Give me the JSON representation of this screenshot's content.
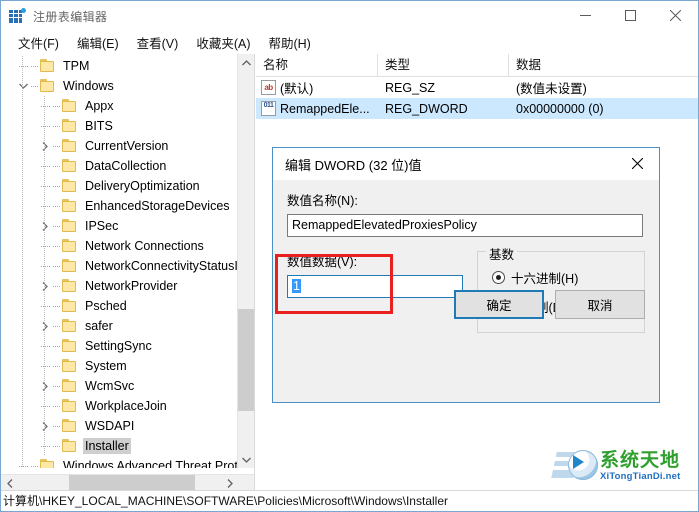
{
  "window": {
    "title": "注册表编辑器",
    "icon": "registry-editor-icon",
    "minimize": "−",
    "maximize": "□",
    "close": "✕"
  },
  "menubar": {
    "items": [
      {
        "label": "文件(F)",
        "name": "menu-file"
      },
      {
        "label": "编辑(E)",
        "name": "menu-edit"
      },
      {
        "label": "查看(V)",
        "name": "menu-view"
      },
      {
        "label": "收藏夹(A)",
        "name": "menu-favorites"
      },
      {
        "label": "帮助(H)",
        "name": "menu-help"
      }
    ]
  },
  "tree": {
    "items": [
      {
        "label": "TPM",
        "indent": 1,
        "expander": "none",
        "selected": false
      },
      {
        "label": "Windows",
        "indent": 1,
        "expander": "expanded",
        "selected": false
      },
      {
        "label": "Appx",
        "indent": 2,
        "expander": "none",
        "selected": false
      },
      {
        "label": "BITS",
        "indent": 2,
        "expander": "none",
        "selected": false
      },
      {
        "label": "CurrentVersion",
        "indent": 2,
        "expander": "collapsed",
        "selected": false
      },
      {
        "label": "DataCollection",
        "indent": 2,
        "expander": "none",
        "selected": false
      },
      {
        "label": "DeliveryOptimization",
        "indent": 2,
        "expander": "none",
        "selected": false
      },
      {
        "label": "EnhancedStorageDevices",
        "indent": 2,
        "expander": "none",
        "selected": false
      },
      {
        "label": "IPSec",
        "indent": 2,
        "expander": "collapsed",
        "selected": false
      },
      {
        "label": "Network Connections",
        "indent": 2,
        "expander": "none",
        "selected": false
      },
      {
        "label": "NetworkConnectivityStatusIndicator",
        "indent": 2,
        "expander": "none",
        "selected": false
      },
      {
        "label": "NetworkProvider",
        "indent": 2,
        "expander": "collapsed",
        "selected": false
      },
      {
        "label": "Psched",
        "indent": 2,
        "expander": "none",
        "selected": false
      },
      {
        "label": "safer",
        "indent": 2,
        "expander": "collapsed",
        "selected": false
      },
      {
        "label": "SettingSync",
        "indent": 2,
        "expander": "none",
        "selected": false
      },
      {
        "label": "System",
        "indent": 2,
        "expander": "none",
        "selected": false
      },
      {
        "label": "WcmSvc",
        "indent": 2,
        "expander": "collapsed",
        "selected": false
      },
      {
        "label": "WorkplaceJoin",
        "indent": 2,
        "expander": "none",
        "selected": false
      },
      {
        "label": "WSDAPI",
        "indent": 2,
        "expander": "collapsed",
        "selected": false
      },
      {
        "label": "Installer",
        "indent": 2,
        "expander": "none",
        "selected": true
      },
      {
        "label": "Windows Advanced Threat Prote",
        "indent": 1,
        "expander": "none",
        "selected": false
      }
    ],
    "scroll_up_icon": "chevron-up-icon",
    "scroll_down_icon": "chevron-down-icon",
    "scroll_left_icon": "chevron-left-icon",
    "scroll_right_icon": "chevron-right-icon"
  },
  "list": {
    "columns": [
      "名称",
      "类型",
      "数据"
    ],
    "rows": [
      {
        "icon": "string-value-icon",
        "icon_glyph": "ab",
        "name": "(默认)",
        "type": "REG_SZ",
        "data": "(数值未设置)",
        "selected": false
      },
      {
        "icon": "dword-value-icon",
        "icon_glyph": "011",
        "name": "RemappedEle...",
        "type": "REG_DWORD",
        "data": "0x00000000 (0)",
        "selected": true
      }
    ]
  },
  "statusbar": {
    "path": "计算机\\HKEY_LOCAL_MACHINE\\SOFTWARE\\Policies\\Microsoft\\Windows\\Installer"
  },
  "dialog": {
    "title": "编辑 DWORD (32 位)值",
    "close_icon": "close-icon",
    "value_name_label": "数值名称(N):",
    "value_name": "RemappedElevatedProxiesPolicy",
    "value_data_label": "数值数据(V):",
    "value_data": "1",
    "base_legend": "基数",
    "base_options": [
      {
        "label": "十六进制(H)",
        "selected": true
      },
      {
        "label": "十进制(D)",
        "selected": false
      }
    ],
    "ok_label": "确定",
    "cancel_label": "取消"
  },
  "watermark": {
    "cn": "系统天地",
    "en": "XiTongTianDi.net"
  }
}
